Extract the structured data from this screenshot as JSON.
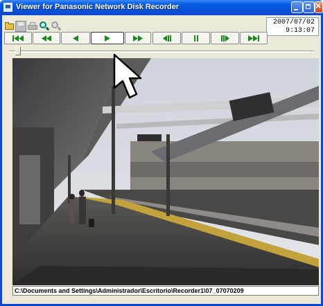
{
  "window": {
    "title": "Viewer for Panasonic Network Disk Recorder"
  },
  "toolbar": {
    "icons": [
      "open-folder-icon",
      "save-icon",
      "print-icon",
      "zoom-in-icon",
      "zoom-out-icon"
    ]
  },
  "timestamp": {
    "date": "2007/07/02",
    "time": "9:13:07"
  },
  "playback": {
    "buttons": [
      "skip-to-start",
      "fast-rewind",
      "reverse-play",
      "play",
      "fast-forward",
      "step-back",
      "pause",
      "step-forward",
      "skip-to-end"
    ],
    "active": "play",
    "color": "#1a8a1a"
  },
  "timeline": {
    "position": 0.02
  },
  "status": {
    "path": "C:\\Documents and Settings\\Administrador\\Escritorio\\Recorder1\\07_07070209"
  }
}
